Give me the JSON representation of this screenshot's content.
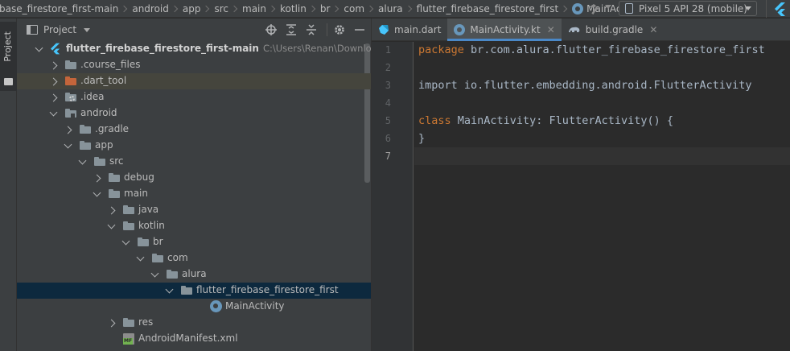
{
  "breadcrumb": [
    "base_firestore_first-main",
    "android",
    "app",
    "src",
    "main",
    "kotlin",
    "br",
    "com",
    "alura",
    "flutter_firebase_firestore_first",
    "MainActivity"
  ],
  "device": {
    "label": "Pixel 5 API 28 (mobile)",
    "icon": "phone-icon"
  },
  "left_strip": {
    "label": "Project"
  },
  "project_panel": {
    "title": "Project",
    "tools": [
      "crosshair-icon",
      "collapse-all-icon",
      "expand-all-icon",
      "gear-icon",
      "minimize-icon"
    ]
  },
  "tree": [
    {
      "label": "flutter_firebase_firestore_first-main",
      "path": "C:\\Users\\Renan\\Downloads\\flutter_f",
      "level": 0,
      "expanded": true,
      "icon": "flutter-icon"
    },
    {
      "label": ".course_files",
      "level": 1,
      "expanded": false,
      "icon": "folder-icon"
    },
    {
      "label": ".dart_tool",
      "level": 1,
      "expanded": false,
      "icon": "folder-excluded-icon"
    },
    {
      "label": ".idea",
      "level": 1,
      "expanded": false,
      "icon": "folder-settings-icon"
    },
    {
      "label": "android",
      "level": 1,
      "expanded": true,
      "icon": "folder-module-icon"
    },
    {
      "label": ".gradle",
      "level": 2,
      "expanded": false,
      "icon": "folder-icon"
    },
    {
      "label": "app",
      "level": 2,
      "expanded": true,
      "icon": "folder-icon"
    },
    {
      "label": "src",
      "level": 3,
      "expanded": true,
      "icon": "folder-icon"
    },
    {
      "label": "debug",
      "level": 4,
      "expanded": false,
      "icon": "folder-icon"
    },
    {
      "label": "main",
      "level": 4,
      "expanded": true,
      "icon": "folder-icon"
    },
    {
      "label": "java",
      "level": 5,
      "expanded": false,
      "icon": "folder-icon"
    },
    {
      "label": "kotlin",
      "level": 5,
      "expanded": true,
      "icon": "folder-icon"
    },
    {
      "label": "br",
      "level": 6,
      "expanded": true,
      "icon": "folder-icon"
    },
    {
      "label": "com",
      "level": 7,
      "expanded": true,
      "icon": "folder-icon"
    },
    {
      "label": "alura",
      "level": 8,
      "expanded": true,
      "icon": "folder-icon"
    },
    {
      "label": "flutter_firebase_firestore_first",
      "level": 9,
      "expanded": true,
      "icon": "folder-icon",
      "selected": true
    },
    {
      "label": "MainActivity",
      "level": 11,
      "icon": "kotlin-class-icon"
    },
    {
      "label": "res",
      "level": 5,
      "expanded": false,
      "icon": "folder-icon"
    },
    {
      "label": "AndroidManifest.xml",
      "level": 5,
      "icon": "manifest-icon"
    }
  ],
  "tabs": [
    {
      "label": "main.dart",
      "icon": "dart-file-icon",
      "active": false,
      "closable": false
    },
    {
      "label": "MainActivity.kt",
      "icon": "kotlin-class-icon",
      "active": true,
      "closable": true
    },
    {
      "label": "build.gradle",
      "icon": "gradle-icon",
      "active": false,
      "closable": true
    }
  ],
  "editor": {
    "current_line": 7,
    "lines": [
      {
        "n": "1",
        "kw": "package",
        "rest": " br.com.alura.flutter_firebase_firestore_first"
      },
      {
        "n": "2",
        "kw": "",
        "rest": ""
      },
      {
        "n": "3",
        "kw": "",
        "rest": "import io.flutter.embedding.android.FlutterActivity"
      },
      {
        "n": "4",
        "kw": "",
        "rest": ""
      },
      {
        "n": "5",
        "kw": "class",
        "rest": " MainActivity: FlutterActivity() {"
      },
      {
        "n": "6",
        "kw": "",
        "rest": "}"
      },
      {
        "n": "7",
        "kw": "",
        "rest": ""
      }
    ]
  },
  "colors": {
    "keyword": "#cc7832",
    "code_text": "#a9b7c6",
    "selection": "#0d293e",
    "tab_underline": "#4a88c7",
    "excluded_folder": "#c4653b"
  }
}
